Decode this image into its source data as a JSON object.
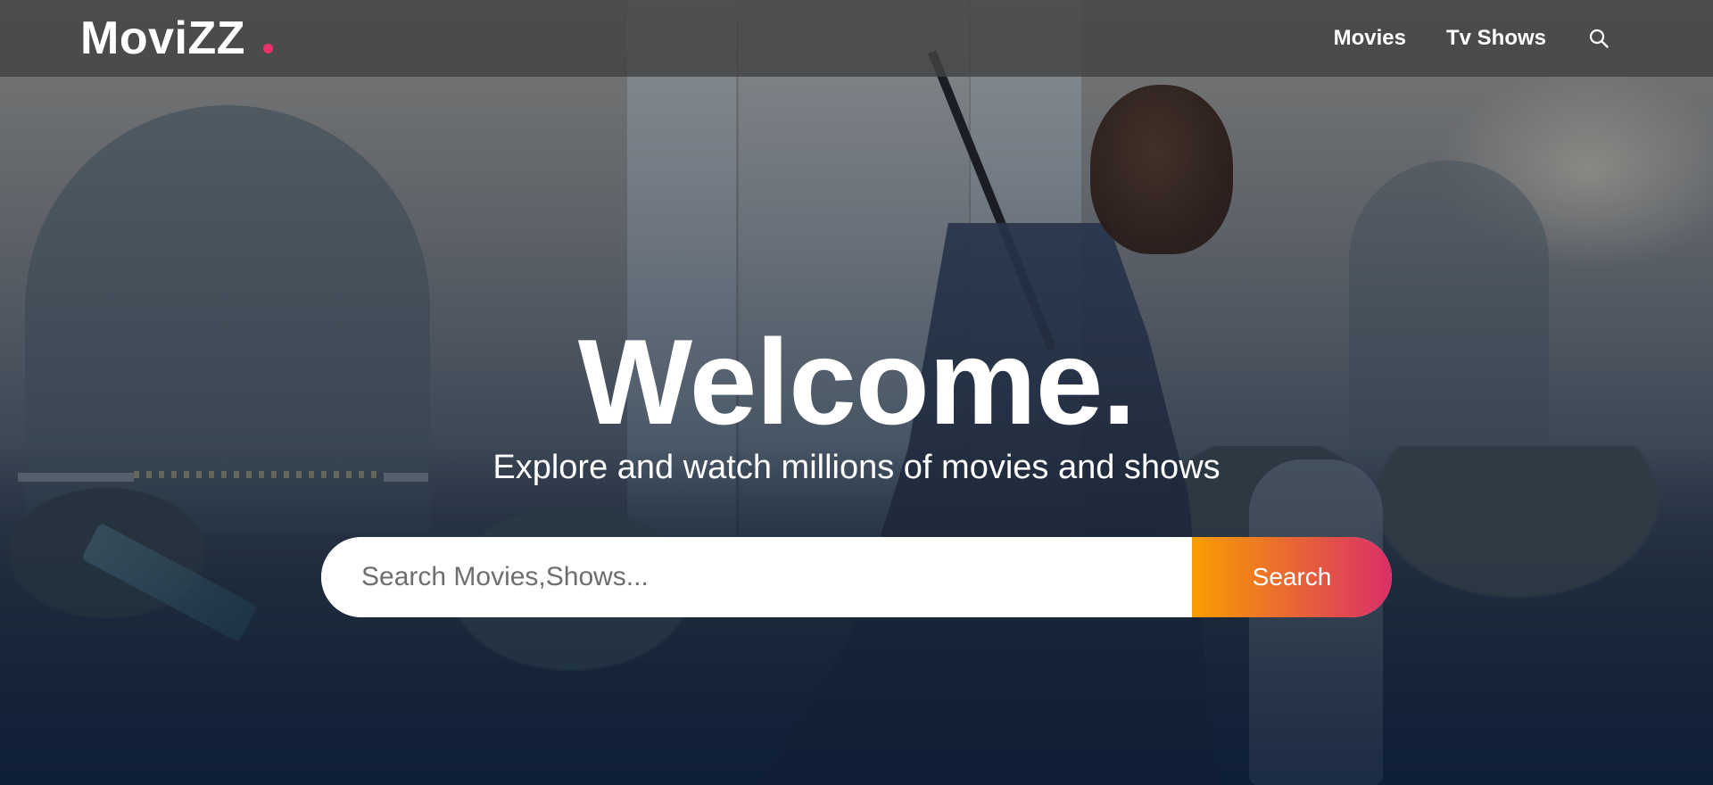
{
  "header": {
    "logo_text": "MoviZZ",
    "nav": [
      {
        "label": "Movies"
      },
      {
        "label": "Tv Shows"
      }
    ],
    "search_icon": "search-icon"
  },
  "hero": {
    "title": "Welcome.",
    "subtitle": "Explore and watch millions of movies and shows",
    "search": {
      "placeholder": "Search Movies,Shows...",
      "value": "",
      "button_label": "Search"
    }
  },
  "colors": {
    "accent_dot": "#e93269",
    "button_gradient_start": "#f89e00",
    "button_gradient_end": "#da2f68",
    "header_bg": "#424242",
    "text": "#ffffff"
  }
}
